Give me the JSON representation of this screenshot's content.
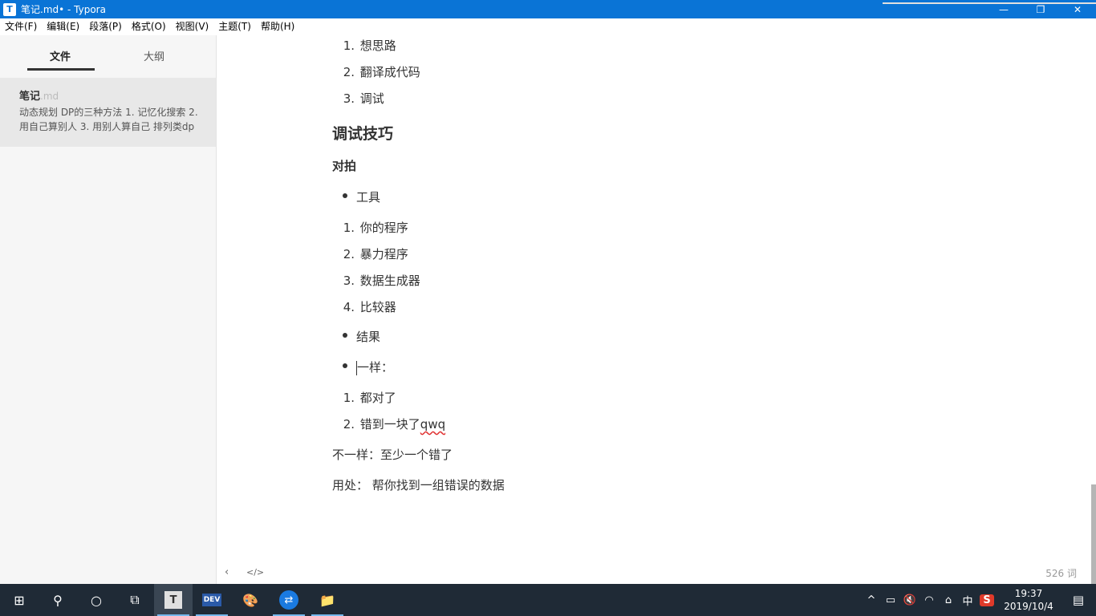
{
  "window": {
    "title": "笔记.md• - Typora",
    "minimize": "—",
    "restore": "❐",
    "close": "✕",
    "app_letter": "T"
  },
  "menu": [
    "文件(F)",
    "编辑(E)",
    "段落(P)",
    "格式(O)",
    "视图(V)",
    "主题(T)",
    "帮助(H)"
  ],
  "sidebar": {
    "tab_files": "文件",
    "tab_outline": "大纲",
    "file": {
      "name": "笔记",
      "ext": ".md",
      "preview": "动态规划 DP的三种方法 1. 记忆化搜索 2. 用自己算别人 3. 用别人算自己 排列类dp"
    }
  },
  "footer": {
    "back": "‹",
    "source": "</>",
    "word_count": "526 词"
  },
  "doc": {
    "list1": [
      "想思路",
      "翻译成代码",
      "调试"
    ],
    "heading": "调试技巧",
    "subheading": "对拍",
    "bullet_tools": "工具",
    "list2": [
      "你的程序",
      "暴力程序",
      "数据生成器",
      "比较器"
    ],
    "bullet_result": "结果",
    "bullet_same": "一样：",
    "list3_1": "都对了",
    "list3_2_prefix": "错到一块了",
    "list3_2_word": "qwq",
    "para1": "不一样：至少一个错了",
    "para2": "用处： 帮你找到一组错误的数据"
  },
  "taskbar": {
    "start": "⊞",
    "search": "⚲",
    "cortana": "○",
    "taskview": "⧉",
    "typora": "T",
    "dev": "DEV",
    "paint": "🎨",
    "teamviewer": "⇄",
    "explorer": "📁",
    "tray_up": "^",
    "battery": "▭",
    "volume": "🔇",
    "wifi": "◠",
    "usb": "⌂",
    "ime": "中",
    "sogou": "S",
    "time": "19:37",
    "date": "2019/10/4",
    "notifications": "▤"
  }
}
